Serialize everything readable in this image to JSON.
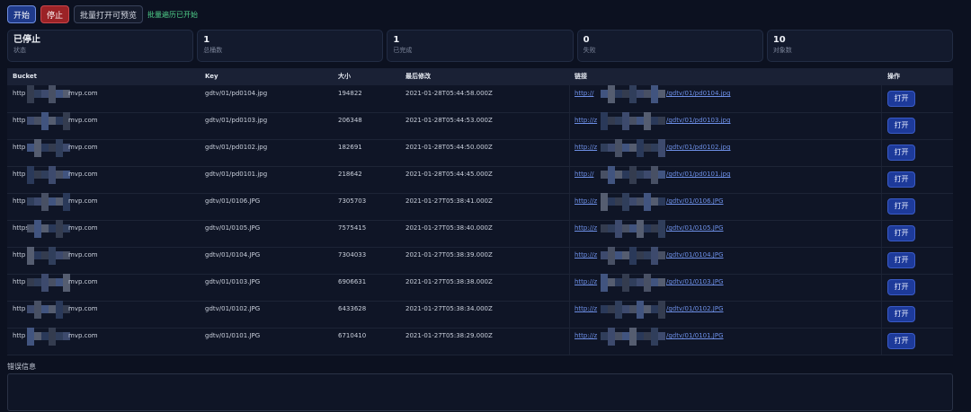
{
  "toolbar": {
    "start_label": "开始",
    "stop_label": "停止",
    "batch_label": "批量打开可预览",
    "status_text": "批量遍历已开始"
  },
  "stats": [
    {
      "value": "已停止",
      "label": "状态"
    },
    {
      "value": "1",
      "label": "总桶数"
    },
    {
      "value": "1",
      "label": "已完成"
    },
    {
      "value": "0",
      "label": "失败"
    },
    {
      "value": "10",
      "label": "对象数"
    }
  ],
  "table": {
    "headers": [
      "Bucket",
      "Key",
      "大小",
      "最后修改",
      "链接",
      "操作"
    ],
    "open_label": "打开",
    "rows": [
      {
        "bucket_start": "http",
        "bucket_end": "mvp.com",
        "key": "gdtv/01/pd0104.jpg",
        "size": "194822",
        "modified": "2021-01-28T05:44:58.000Z",
        "link_start": "http://",
        "link_end": "/gdtv/01/pd0104.jpg"
      },
      {
        "bucket_start": "http",
        "bucket_end": "mvp.com",
        "key": "gdtv/01/pd0103.jpg",
        "size": "206348",
        "modified": "2021-01-28T05:44:53.000Z",
        "link_start": "http://z",
        "link_end": "/gdtv/01/pd0103.jpg"
      },
      {
        "bucket_start": "http",
        "bucket_end": "mvp.com",
        "key": "gdtv/01/pd0102.jpg",
        "size": "182691",
        "modified": "2021-01-28T05:44:50.000Z",
        "link_start": "http://z",
        "link_end": "/gdtv/01/pd0102.jpg"
      },
      {
        "bucket_start": "http",
        "bucket_end": "mvp.com",
        "key": "gdtv/01/pd0101.jpg",
        "size": "218642",
        "modified": "2021-01-28T05:44:45.000Z",
        "link_start": "http://",
        "link_end": "/gdtv/01/pd0101.jpg"
      },
      {
        "bucket_start": "http",
        "bucket_end": "mvp.com",
        "key": "gdtv/01/0106.JPG",
        "size": "7305703",
        "modified": "2021-01-27T05:38:41.000Z",
        "link_start": "http://z",
        "link_end": "/gdtv/01/0106.JPG"
      },
      {
        "bucket_start": "https",
        "bucket_end": "mvp.com",
        "key": "gdtv/01/0105.JPG",
        "size": "7575415",
        "modified": "2021-01-27T05:38:40.000Z",
        "link_start": "http://z",
        "link_end": "/gdtv/01/0105.JPG"
      },
      {
        "bucket_start": "http",
        "bucket_end": "mvp.com",
        "key": "gdtv/01/0104.JPG",
        "size": "7304033",
        "modified": "2021-01-27T05:38:39.000Z",
        "link_start": "http://z",
        "link_end": "/gdtv/01/0104.JPG"
      },
      {
        "bucket_start": "http",
        "bucket_end": "mvp.com",
        "key": "gdtv/01/0103.JPG",
        "size": "6906631",
        "modified": "2021-01-27T05:38:38.000Z",
        "link_start": "http://z",
        "link_end": "/gdtv/01/0103.JPG"
      },
      {
        "bucket_start": "http",
        "bucket_end": "mvp.com",
        "key": "gdtv/01/0102.JPG",
        "size": "6433628",
        "modified": "2021-01-27T05:38:34.000Z",
        "link_start": "http://z",
        "link_end": "/gdtv/01/0102.JPG"
      },
      {
        "bucket_start": "http",
        "bucket_end": "mvp.com",
        "key": "gdtv/01/0101.JPG",
        "size": "6710410",
        "modified": "2021-01-27T05:38:29.000Z",
        "link_start": "http://z",
        "link_end": "/gdtv/01/0101.JPG"
      }
    ]
  },
  "error": {
    "label": "错误信息",
    "value": ""
  }
}
